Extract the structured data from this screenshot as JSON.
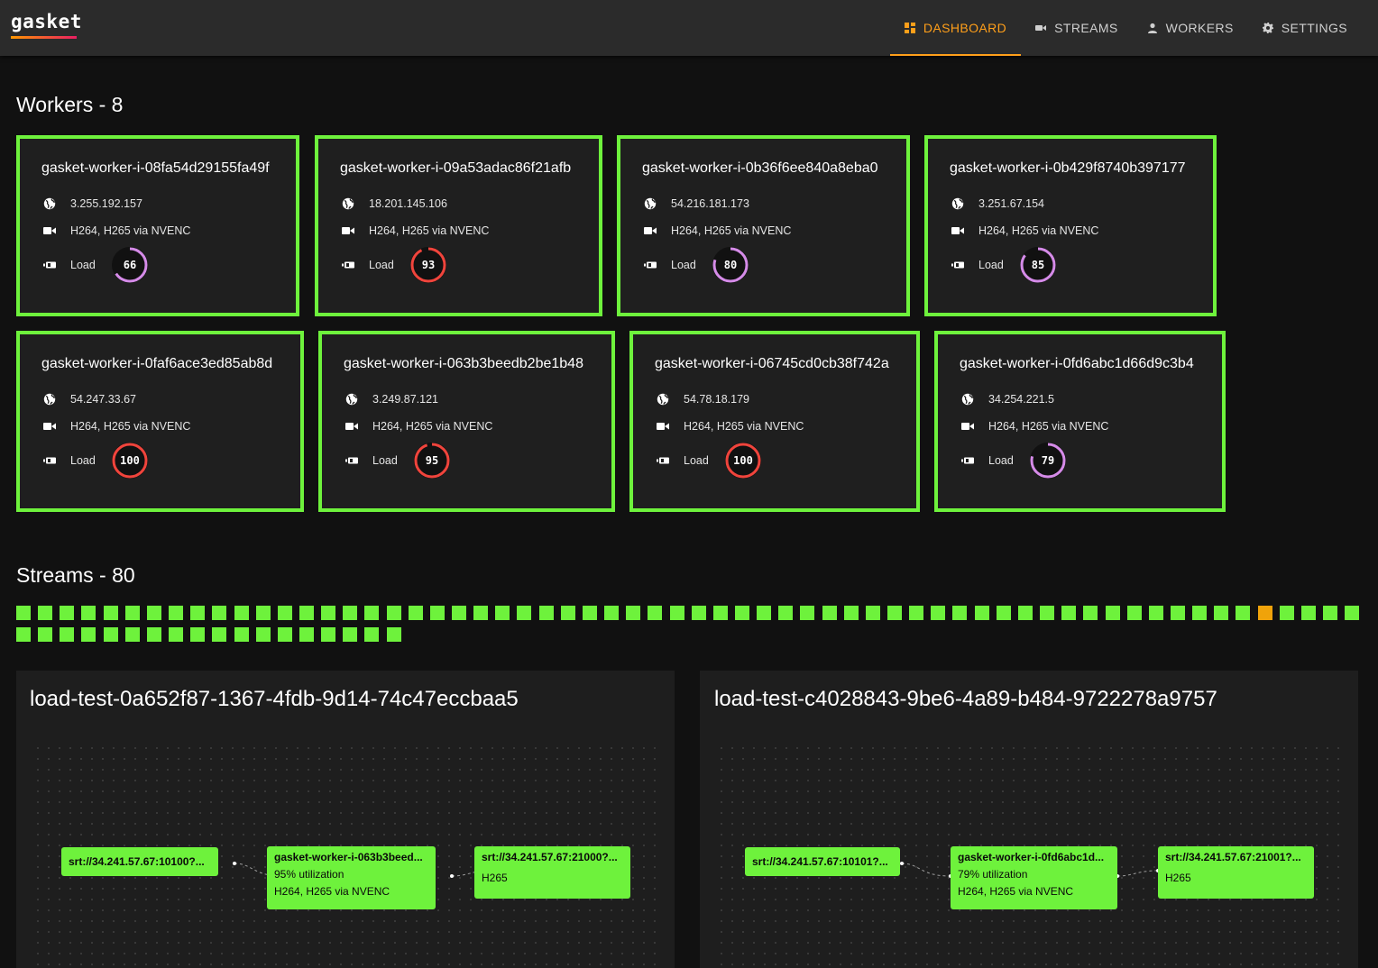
{
  "app": {
    "logo": "gasket",
    "nav": [
      {
        "label": "DASHBOARD",
        "icon": "dashboard-icon",
        "active": true
      },
      {
        "label": "STREAMS",
        "icon": "camera-icon",
        "active": false
      },
      {
        "label": "WORKERS",
        "icon": "person-icon",
        "active": false
      },
      {
        "label": "SETTINGS",
        "icon": "gear-icon",
        "active": false
      }
    ]
  },
  "colors": {
    "accent": "#ff9f1a",
    "healthy": "#6ef23c",
    "warning": "#f0a30a",
    "gauge_high": "#f0443c",
    "gauge_mid": "#d58be8"
  },
  "workers_section": {
    "title": "Workers - 8",
    "load_label": "Load",
    "workers": [
      {
        "name": "gasket-worker-i-08fa54d29155fa49f",
        "ip": "3.255.192.157",
        "codecs": "H264, H265 via NVENC",
        "load": 66
      },
      {
        "name": "gasket-worker-i-09a53adac86f21afb",
        "ip": "18.201.145.106",
        "codecs": "H264, H265 via NVENC",
        "load": 93
      },
      {
        "name": "gasket-worker-i-0b36f6ee840a8eba0",
        "ip": "54.216.181.173",
        "codecs": "H264, H265 via NVENC",
        "load": 80
      },
      {
        "name": "gasket-worker-i-0b429f8740b397177",
        "ip": "3.251.67.154",
        "codecs": "H264, H265 via NVENC",
        "load": 85
      },
      {
        "name": "gasket-worker-i-0faf6ace3ed85ab8d",
        "ip": "54.247.33.67",
        "codecs": "H264, H265 via NVENC",
        "load": 100
      },
      {
        "name": "gasket-worker-i-063b3beedb2be1b48",
        "ip": "3.249.87.121",
        "codecs": "H264, H265 via NVENC",
        "load": 95
      },
      {
        "name": "gasket-worker-i-06745cd0cb38f742a",
        "ip": "54.78.18.179",
        "codecs": "H264, H265 via NVENC",
        "load": 100
      },
      {
        "name": "gasket-worker-i-0fd6abc1d66d9c3b4",
        "ip": "34.254.221.5",
        "codecs": "H264, H265 via NVENC",
        "load": 79
      }
    ]
  },
  "streams_section": {
    "title": "Streams - 80",
    "total": 80,
    "warning_index": 57,
    "cards": [
      {
        "title": "load-test-0a652f87-1367-4fdb-9d14-74c47eccbaa5",
        "input": "srt://34.241.57.67:10100?...",
        "worker": {
          "name": "gasket-worker-i-063b3beed...",
          "utilization": "95% utilization",
          "codecs": "H264, H265 via NVENC"
        },
        "output": {
          "url": "srt://34.241.57.67:21000?...",
          "codec": "H265"
        }
      },
      {
        "title": "load-test-c4028843-9be6-4a89-b484-9722278a9757",
        "input": "srt://34.241.57.67:10101?...",
        "worker": {
          "name": "gasket-worker-i-0fd6abc1d...",
          "utilization": "79% utilization",
          "codecs": "H264, H265 via NVENC"
        },
        "output": {
          "url": "srt://34.241.57.67:21001?...",
          "codec": "H265"
        }
      }
    ]
  }
}
